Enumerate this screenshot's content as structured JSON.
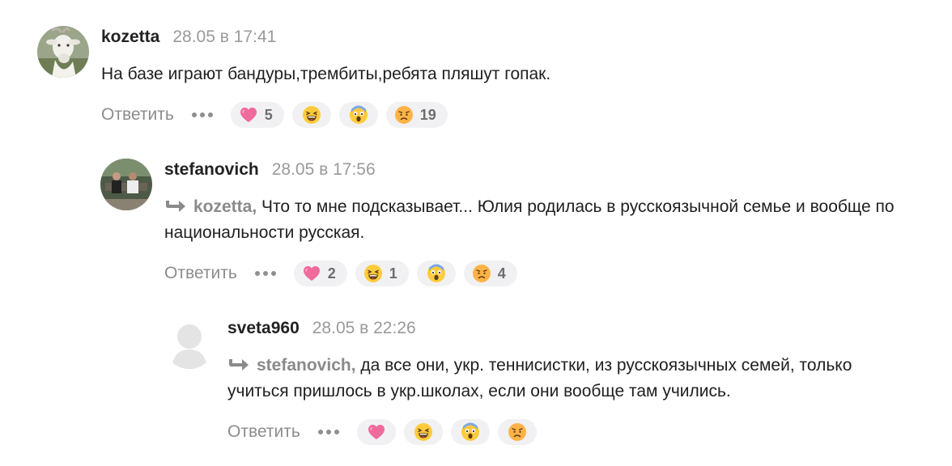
{
  "comments": [
    {
      "author": "kozetta",
      "time": "28.05 в 17:41",
      "reply_to": "",
      "text": "На базе играют бандуры,трембиты,ребята пляшут гопак.",
      "reply_label": "Ответить",
      "reactions": {
        "heart": "5",
        "laugh": "",
        "shock": "",
        "sad": "19"
      }
    },
    {
      "author": "stefanovich",
      "time": "28.05 в 17:56",
      "reply_to": "kozetta,",
      "text": "Что то мне подсказывает... Юлия родилась в русскоязычной семье и вообще по национальности русская.",
      "reply_label": "Ответить",
      "reactions": {
        "heart": "2",
        "laugh": "1",
        "shock": "",
        "sad": "4"
      }
    },
    {
      "author": "sveta960",
      "time": "28.05 в 22:26",
      "reply_to": "stefanovich,",
      "text": "да все они, укр. теннисистки, из русскоязычных семей, только учиться пришлось в укр.школах, если они вообще там учились.",
      "reply_label": "Ответить",
      "reactions": {
        "heart": "",
        "laugh": "",
        "shock": "",
        "sad": ""
      }
    }
  ],
  "icons": {
    "reply_arrow": "reply-arrow-icon",
    "more": "more-dots-icon",
    "reactions": [
      "heart-icon",
      "laughing-face-icon",
      "shocked-face-icon",
      "sad-face-icon"
    ]
  },
  "colors": {
    "author": "#222222",
    "timestamp": "#9a9a9a",
    "muted": "#8c8c8c",
    "reaction_bg": "#f1f1f3",
    "heart": "#f06a9b"
  }
}
